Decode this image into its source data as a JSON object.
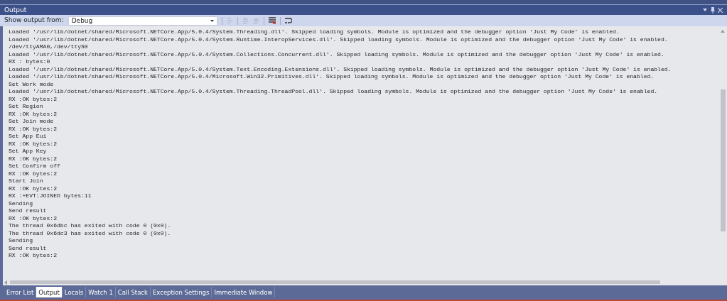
{
  "window": {
    "title": "Output"
  },
  "toolbar": {
    "label": "Show output from:",
    "source": "Debug"
  },
  "output_lines": [
    "Loaded '/usr/lib/dotnet/shared/Microsoft.NETCore.App/5.0.4/System.Threading.dll'. Skipped loading symbols. Module is optimized and the debugger option 'Just My Code' is enabled.",
    "Loaded '/usr/lib/dotnet/shared/Microsoft.NETCore.App/5.0.4/System.Runtime.InteropServices.dll'. Skipped loading symbols. Module is optimized and the debugger option 'Just My Code' is enabled.",
    "/dev/ttyAMA0,/dev/ttyS0",
    "Loaded '/usr/lib/dotnet/shared/Microsoft.NETCore.App/5.0.4/System.Collections.Concurrent.dll'. Skipped loading symbols. Module is optimized and the debugger option 'Just My Code' is enabled.",
    "RX : bytes:0",
    "Loaded '/usr/lib/dotnet/shared/Microsoft.NETCore.App/5.0.4/System.Text.Encoding.Extensions.dll'. Skipped loading symbols. Module is optimized and the debugger option 'Just My Code' is enabled.",
    "Loaded '/usr/lib/dotnet/shared/Microsoft.NETCore.App/5.0.4/Microsoft.Win32.Primitives.dll'. Skipped loading symbols. Module is optimized and the debugger option 'Just My Code' is enabled.",
    "Set Work mode",
    "Loaded '/usr/lib/dotnet/shared/Microsoft.NETCore.App/5.0.4/System.Threading.ThreadPool.dll'. Skipped loading symbols. Module is optimized and the debugger option 'Just My Code' is enabled.",
    "RX :OK bytes:2",
    "Set Region",
    "RX :OK bytes:2",
    "Set Join mode",
    "RX :OK bytes:2",
    "Set App Eui",
    "RX :OK bytes:2",
    "Set App Key",
    "RX :OK bytes:2",
    "Set Confirm off",
    "RX :OK bytes:2",
    "Start Join",
    "RX :OK bytes:2",
    "RX :+EVT:JOINED bytes:11",
    "Sending",
    "Send result",
    "RX :OK bytes:2",
    "The thread 0x6dbc has exited with code 0 (0x0).",
    "The thread 0x6dc3 has exited with code 0 (0x0).",
    "Sending",
    "Send result",
    "RX :OK bytes:2"
  ],
  "tabs": [
    {
      "label": "Error List",
      "selected": false
    },
    {
      "label": "Output",
      "selected": true
    },
    {
      "label": "Locals",
      "selected": false
    },
    {
      "label": "Watch 1",
      "selected": false
    },
    {
      "label": "Call Stack",
      "selected": false
    },
    {
      "label": "Exception Settings",
      "selected": false
    },
    {
      "label": "Immediate Window",
      "selected": false
    }
  ]
}
